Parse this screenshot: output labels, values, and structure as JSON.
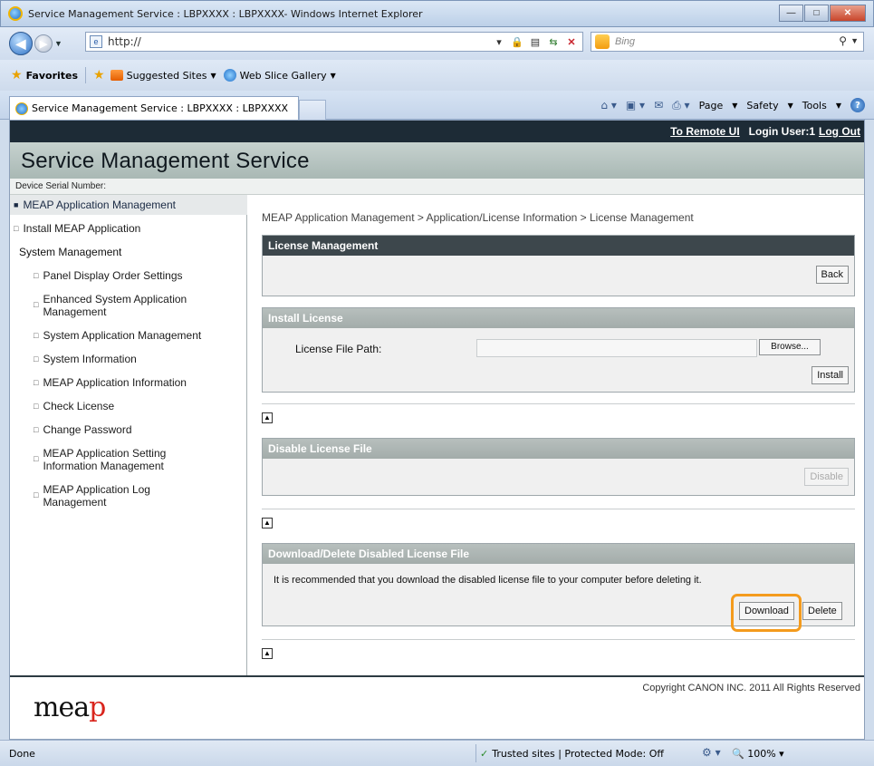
{
  "browser": {
    "title": "Service Management Service : LBPXXXX : LBPXXXX- Windows Internet Explorer",
    "url": "http://",
    "search_placeholder": "Bing",
    "favorites_label": "Favorites",
    "fav_items": [
      "Suggested Sites",
      "Web Slice Gallery"
    ],
    "tab_title": "Service Management Service : LBPXXXX : LBPXXXX",
    "cmd": [
      "Page",
      "Safety",
      "Tools"
    ],
    "status_left": "Done",
    "status_zone": "Trusted sites | Protected Mode: Off",
    "zoom": "100%"
  },
  "header": {
    "remote_ui": "To Remote UI",
    "login_user": "Login User:1",
    "logout": "Log Out",
    "title": "Service Management Service",
    "serial_label": "Device Serial Number:"
  },
  "sidebar": {
    "items": [
      {
        "label": "MEAP Application Management",
        "active": true
      },
      {
        "label": "Install MEAP Application"
      }
    ],
    "section": "System Management",
    "sub": [
      "Panel Display Order Settings",
      "Enhanced System Application Management",
      "System Application Management",
      "System Information",
      "MEAP Application Information",
      "Check License",
      "Change Password",
      "MEAP Application Setting Information Management",
      "MEAP Application Log Management"
    ]
  },
  "main": {
    "breadcrumb": "MEAP Application Management > Application/License Information > License Management",
    "license_mgmt": {
      "title": "License Management",
      "back": "Back"
    },
    "install_license": {
      "title": "Install License",
      "path_label": "License File Path:",
      "path_value": "",
      "browse": "Browse...",
      "install": "Install"
    },
    "disable_license": {
      "title": "Disable License File",
      "disable": "Disable"
    },
    "download_delete": {
      "title": "Download/Delete Disabled License File",
      "message": "It is recommended that you download the disabled license file to your computer before deleting it.",
      "download": "Download",
      "delete": "Delete"
    }
  },
  "footer": {
    "copyright": "Copyright CANON INC. 2011 All Rights Reserved",
    "logo": "meap"
  },
  "colors": {
    "highlight": "#f49b1d",
    "topbar": "#1d2b36",
    "panel_dark": "#3d474c"
  }
}
